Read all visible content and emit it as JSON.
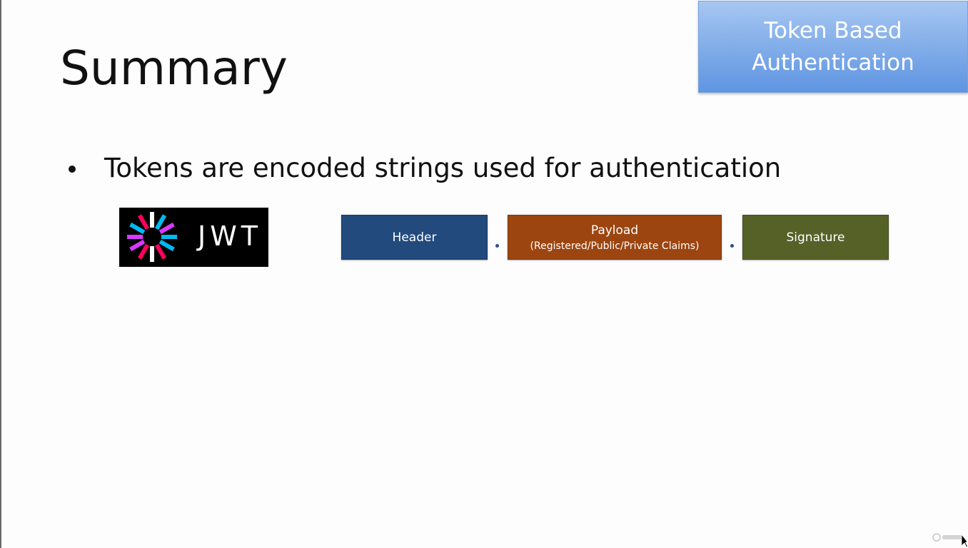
{
  "slide": {
    "title": "Summary",
    "topic_box": "Token Based\nAuthentication",
    "bullets": [
      "Tokens are encoded strings used for authentication"
    ]
  },
  "jwt_logo": {
    "wordmark": "JWT",
    "icon": "jwt-logo-icon",
    "colors": [
      "#00b9f1",
      "#d63aff",
      "#fb015b",
      "#ffffff"
    ]
  },
  "token_parts": [
    {
      "label": "Header",
      "sub": "",
      "color": "#224a7d"
    },
    {
      "label": "Payload",
      "sub": "(Registered/Public/Private Claims)",
      "color": "#9c4510"
    },
    {
      "label": "Signature",
      "sub": "",
      "color": "#566128"
    }
  ],
  "separator": ".",
  "icons": {
    "watermark": "udemy-watermark-icon",
    "cursor": "mouse-cursor-icon"
  }
}
